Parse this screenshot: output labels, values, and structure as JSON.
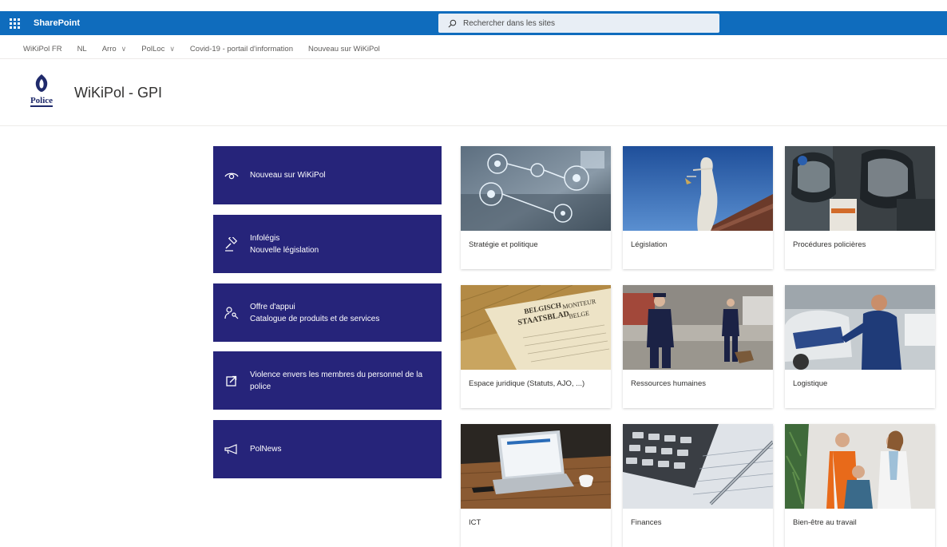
{
  "suite_bar": {
    "app_name": "SharePoint",
    "search_placeholder": "Rechercher dans les sites",
    "color": "#0f6cbd"
  },
  "hub_nav": [
    {
      "label": "WiKiPol FR",
      "dropdown": false
    },
    {
      "label": "NL",
      "dropdown": false
    },
    {
      "label": "Arro",
      "dropdown": true
    },
    {
      "label": "PolLoc",
      "dropdown": true
    },
    {
      "label": "Covid-19 - portail d'information",
      "dropdown": false
    },
    {
      "label": "Nouveau sur WiKiPol",
      "dropdown": false
    }
  ],
  "site": {
    "logo_text": "Police",
    "title": "WiKiPol - GPI"
  },
  "quick_links": [
    {
      "icon": "eye-icon",
      "label": "Nouveau sur WiKiPol"
    },
    {
      "icon": "gavel-icon",
      "label": "Infolégis\nNouvelle législation"
    },
    {
      "icon": "person-key-icon",
      "label": "Offre d'appui\nCatalogue de produits et de services"
    },
    {
      "icon": "open-external-icon",
      "label": "Violence envers les membres du personnel de la police"
    },
    {
      "icon": "megaphone-icon",
      "label": "PolNews"
    }
  ],
  "quick_link_color": "#26247a",
  "tiles": [
    {
      "label": "Stratégie et politique"
    },
    {
      "label": "Législation"
    },
    {
      "label": "Procédures policières"
    },
    {
      "label": "Espace juridique (Statuts, AJO, ...)"
    },
    {
      "label": "Ressources humaines"
    },
    {
      "label": "Logistique"
    },
    {
      "label": "ICT"
    },
    {
      "label": "Finances"
    },
    {
      "label": "Bien-être au travail"
    }
  ],
  "image_texts": {
    "staatsblad_1": "BELGISCH",
    "staatsblad_2": "STAATSBLAD",
    "moniteur_1": "MONITEUR",
    "moniteur_2": "BELGE"
  }
}
